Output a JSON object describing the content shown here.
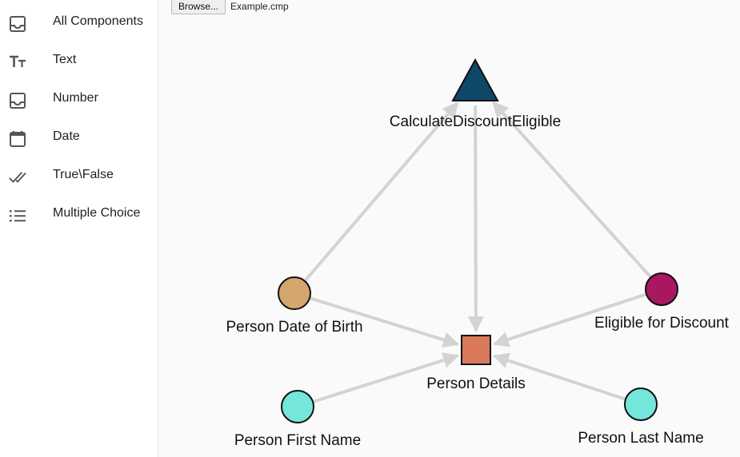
{
  "sidebar": {
    "items": [
      {
        "label": "All Components",
        "icon": "inbox-icon"
      },
      {
        "label": "Text",
        "icon": "text-format-icon"
      },
      {
        "label": "Number",
        "icon": "inbox-icon"
      },
      {
        "label": "Date",
        "icon": "calendar-icon"
      },
      {
        "label": "True\\False",
        "icon": "double-check-icon"
      },
      {
        "label": "Multiple Choice",
        "icon": "list-icon"
      }
    ]
  },
  "file": {
    "browse_label": "Browse...",
    "file_name": "Example.cmp"
  },
  "graph": {
    "nodes": [
      {
        "id": "calc",
        "label": "CalculateDiscountEligible",
        "shape": "triangle",
        "color": "#0d4868"
      },
      {
        "id": "dob",
        "label": "Person Date of Birth",
        "shape": "circle",
        "color": "#d5a56e"
      },
      {
        "id": "elig",
        "label": "Eligible for Discount",
        "shape": "circle",
        "color": "#a8175f"
      },
      {
        "id": "details",
        "label": "Person Details",
        "shape": "square",
        "color": "#d9795a"
      },
      {
        "id": "first",
        "label": "Person First Name",
        "shape": "circle",
        "color": "#74e6da"
      },
      {
        "id": "last",
        "label": "Person Last Name",
        "shape": "circle",
        "color": "#74e6da"
      }
    ],
    "edges": [
      {
        "from": "dob",
        "to": "calc"
      },
      {
        "from": "elig",
        "to": "calc"
      },
      {
        "from": "calc",
        "to": "details"
      },
      {
        "from": "dob",
        "to": "details"
      },
      {
        "from": "elig",
        "to": "details"
      },
      {
        "from": "first",
        "to": "details"
      },
      {
        "from": "last",
        "to": "details"
      }
    ],
    "edge_color": "#d3d3d3"
  }
}
